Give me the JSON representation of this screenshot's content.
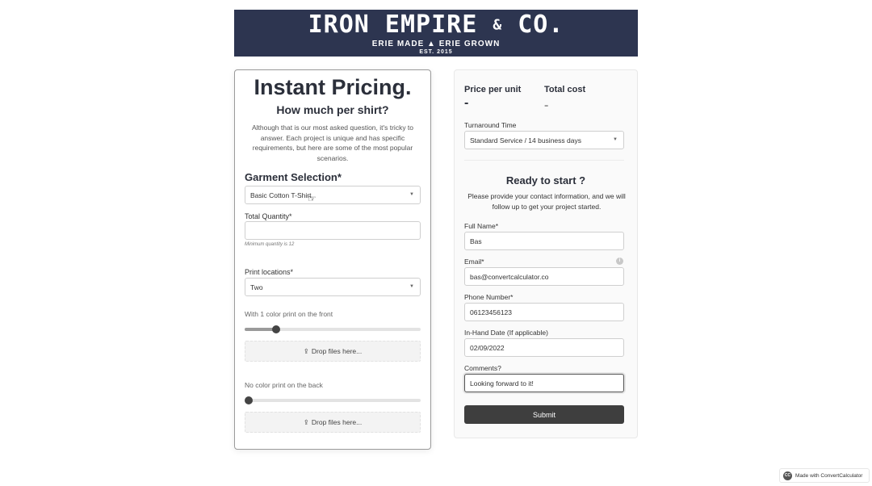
{
  "banner": {
    "brand_left": "IRON EMPIRE",
    "brand_amp": "&",
    "brand_right": "CO.",
    "tagline_left": "ERIE MADE",
    "tagline_right": "ERIE GROWN",
    "est": "EST. 2015",
    "leaf_icon": "leaf-icon",
    "bg_color": "#2d3550"
  },
  "left": {
    "title": "Instant Pricing.",
    "subtitle": "How much per shirt?",
    "description": "Although that is our most asked question, it's tricky to answer. Each project is unique and has specific requirements, but here are some of the most popular scenarios.",
    "garment_section": "Garment Selection*",
    "garment_value": "Basic Cotton T-Shirt",
    "quantity_label": "Total Quantity*",
    "quantity_value": "",
    "quantity_hint": "Minimum quantity is 12",
    "print_locations_label": "Print locations*",
    "print_locations_value": "Two",
    "front_label": "With 1 color print on the front",
    "front_slider_fraction": 0.18,
    "back_label": "No color print on the back",
    "back_slider_fraction": 0,
    "dropzone_label": "Drop files here...",
    "upload_icon": "upload-icon"
  },
  "right": {
    "price_unit_label": "Price per unit",
    "price_unit_value": "-",
    "total_cost_label": "Total cost",
    "total_cost_value": "-",
    "turnaround_label": "Turnaround Time",
    "turnaround_value": "Standard Service / 14 business days",
    "ready_title": "Ready to start ?",
    "ready_desc": "Please provide your contact information, and we will follow up to get your project started.",
    "full_name_label": "Full Name*",
    "full_name_value": "Bas",
    "email_label": "Email*",
    "email_value": "bas@convertcalculator.co",
    "phone_label": "Phone Number*",
    "phone_value": "06123456123",
    "date_label": "In-Hand Date (If applicable)",
    "date_value": "02/09/2022",
    "comments_label": "Comments?",
    "comments_value": "Looking forward to it!",
    "submit_label": "Submit"
  },
  "footer": {
    "made_with": "Made with ConvertCalculator",
    "logo_text": "CC"
  }
}
